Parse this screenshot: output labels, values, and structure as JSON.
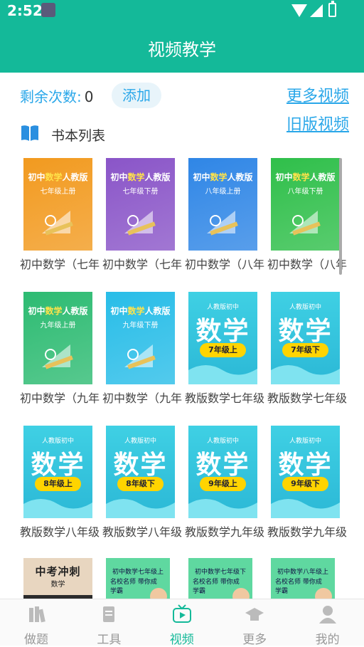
{
  "status_bar": {
    "time": "2:52"
  },
  "header": {
    "title": "视频教学"
  },
  "quota": {
    "label": "剩余次数:",
    "count": "0"
  },
  "add_button": "添加",
  "links": {
    "more_videos": "更多视频",
    "old_videos": "旧版视频"
  },
  "section": {
    "title": "书本列表"
  },
  "books": [
    {
      "title": "初中数学（七年级上册）",
      "cover_title_a": "初中",
      "cover_title_hl": "数学",
      "cover_title_b": "人教版",
      "cover_sub": "七年级上册",
      "style": "a",
      "color": "#f29a1f"
    },
    {
      "title": "初中数学（七年级下册）",
      "cover_title_a": "初中",
      "cover_title_hl": "数学",
      "cover_title_b": "人教版",
      "cover_sub": "七年级下册",
      "style": "a",
      "color": "#8a55c8"
    },
    {
      "title": "初中数学（八年级上册）",
      "cover_title_a": "初中",
      "cover_title_hl": "数学",
      "cover_title_b": "人教版",
      "cover_sub": "八年级上册",
      "style": "a",
      "color": "#2f86e6"
    },
    {
      "title": "初中数学（八年级下册）",
      "cover_title_a": "初中",
      "cover_title_hl": "数学",
      "cover_title_b": "人教版",
      "cover_sub": "八年级下册",
      "style": "a",
      "color": "#2fbf4a"
    },
    {
      "title": "初中数学（九年级上册）",
      "cover_title_a": "初中",
      "cover_title_hl": "数学",
      "cover_title_b": "人教版",
      "cover_sub": "九年级上册",
      "style": "a",
      "color": "#2dbb72"
    },
    {
      "title": "初中数学（九年级下册）",
      "cover_title_a": "初中",
      "cover_title_hl": "数学",
      "cover_title_b": "人教版",
      "cover_sub": "九年级下册",
      "style": "a",
      "color": "#28bde8"
    },
    {
      "title": "教版数学七年级上册",
      "cover_small": "人教版初中",
      "cover_big": "数学",
      "cover_grade": "7年级上",
      "style": "b",
      "color": "#39c6dc"
    },
    {
      "title": "教版数学七年级下册",
      "cover_small": "人教版初中",
      "cover_big": "数学",
      "cover_grade": "7年级下",
      "style": "b",
      "color": "#39c6dc"
    },
    {
      "title": "教版数学八年级上册",
      "cover_small": "人教版初中",
      "cover_big": "数学",
      "cover_grade": "8年级上",
      "style": "b",
      "color": "#39c6dc"
    },
    {
      "title": "教版数学八年级下册",
      "cover_small": "人教版初中",
      "cover_big": "数学",
      "cover_grade": "8年级下",
      "style": "b",
      "color": "#39c6dc"
    },
    {
      "title": "教版数学九年级上册",
      "cover_small": "人教版初中",
      "cover_big": "数学",
      "cover_grade": "9年级上",
      "style": "b",
      "color": "#39c6dc"
    },
    {
      "title": "教版数学九年级下册",
      "cover_small": "人教版初中",
      "cover_big": "数学",
      "cover_grade": "9年级下",
      "style": "b",
      "color": "#39c6dc"
    },
    {
      "title": "",
      "cover_big": "中考冲刺",
      "cover_small": "数学",
      "style": "c",
      "color": "#c98a4e"
    },
    {
      "title": "",
      "cover_small": "初中数学七年级上",
      "cover_sub": "名校名师 带你成学霸",
      "style": "d",
      "color": "#55d699"
    },
    {
      "title": "",
      "cover_small": "初中数学七年级下",
      "cover_sub": "名校名师 带你成学霸",
      "style": "d",
      "color": "#55d699"
    },
    {
      "title": "",
      "cover_small": "初中数学八年级上",
      "cover_sub": "名校名师 带你成学霸",
      "style": "d",
      "color": "#55d699"
    }
  ],
  "tabs": [
    {
      "label": "做题",
      "icon": "books-icon",
      "active": false
    },
    {
      "label": "工具",
      "icon": "document-icon",
      "active": false
    },
    {
      "label": "视频",
      "icon": "tv-play-icon",
      "active": true
    },
    {
      "label": "更多",
      "icon": "graduation-cap-icon",
      "active": false
    },
    {
      "label": "我的",
      "icon": "person-icon",
      "active": false
    }
  ],
  "colors": {
    "primary": "#14b999",
    "link": "#2aa7e9",
    "inactive_tab": "#999999"
  }
}
